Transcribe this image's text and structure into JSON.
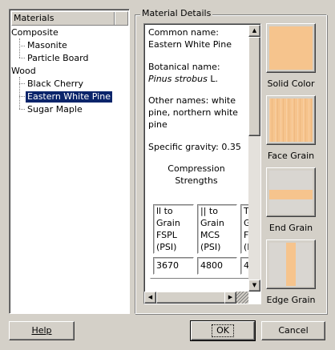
{
  "materials_panel": {
    "header": "Materials",
    "categories": [
      {
        "label": "Composite",
        "items": [
          "Masonite",
          "Particle Board"
        ]
      },
      {
        "label": "Wood",
        "items": [
          "Black Cherry",
          "Eastern White Pine",
          "Sugar Maple"
        ]
      }
    ],
    "selected_item": "Eastern White Pine"
  },
  "details": {
    "legend": "Material Details",
    "common_name_label": "Common name:",
    "common_name": "Eastern White Pine",
    "botanical_label": "Botanical name:",
    "botanical_genus": "Pinus strobus",
    "botanical_author": "L.",
    "other_names_line1": "Other names: white",
    "other_names_line2": "pine, northern white",
    "other_names_line3": "pine",
    "specific_gravity": "Specific gravity: 0.35",
    "compression_title_1": "Compression",
    "compression_title_2": "Strengths",
    "table": {
      "headers": [
        [
          "ll to",
          "Grain",
          "FSPL",
          "(PSI)"
        ],
        [
          "|| to",
          "Grain",
          "MCS",
          "(PSI)"
        ],
        [
          "T",
          "G",
          "F",
          "(F"
        ]
      ],
      "values": [
        "3670",
        "4800",
        "4"
      ]
    },
    "scroll": {
      "up": "▲",
      "down": "▼",
      "left": "◀",
      "right": "▶"
    }
  },
  "swatches": [
    {
      "label": "Solid Color"
    },
    {
      "label": "Face Grain"
    },
    {
      "label": "End Grain"
    },
    {
      "label": "Edge Grain"
    }
  ],
  "buttons": {
    "help": "Help",
    "ok": "OK",
    "cancel": "Cancel"
  },
  "colors": {
    "wood": "#f6c48d",
    "selection": "#0a246a",
    "window": "#d4d0c8"
  }
}
